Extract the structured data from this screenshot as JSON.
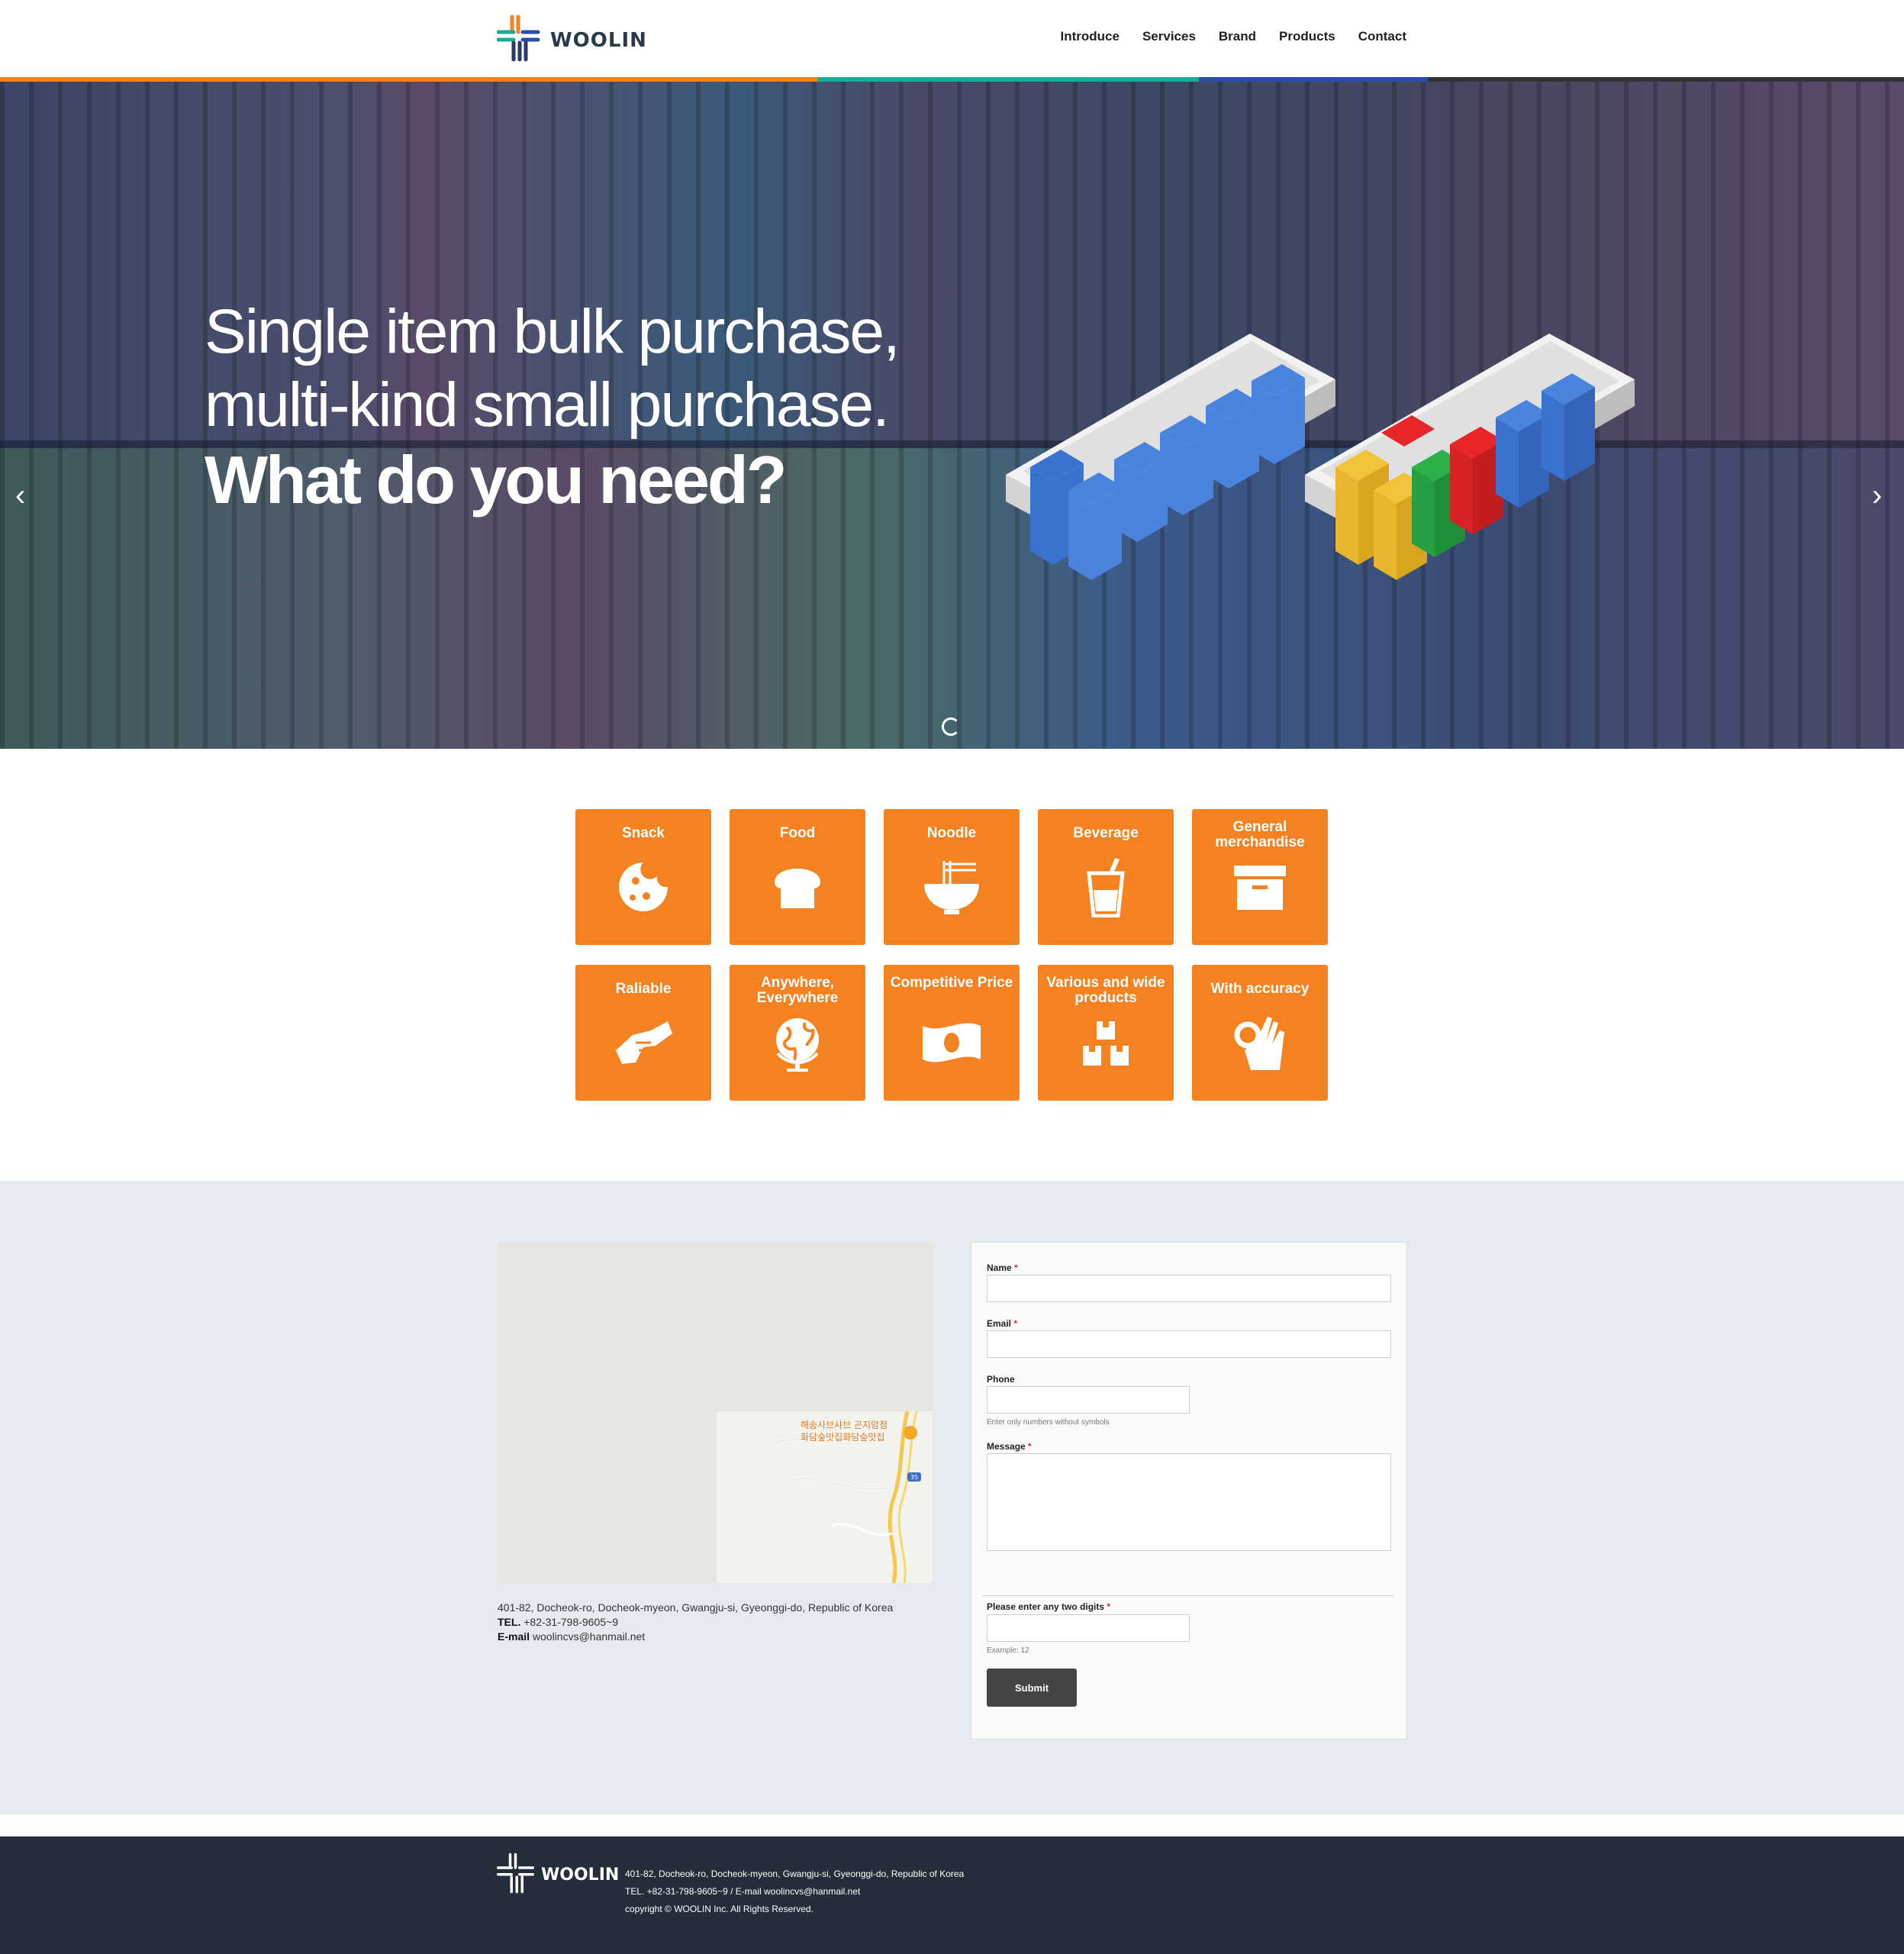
{
  "brand": {
    "name": "WOOLIN"
  },
  "nav": [
    {
      "label": "Introduce"
    },
    {
      "label": "Services"
    },
    {
      "label": "Brand"
    },
    {
      "label": "Products"
    },
    {
      "label": "Contact"
    }
  ],
  "accent_colors": {
    "orange": "#f58220",
    "teal": "#1ea89a",
    "blue": "#2a4ea8"
  },
  "hero": {
    "line1": "Single item bulk purchase,",
    "line2": "multi-kind small purchase.",
    "line3": "What do you need?",
    "prev_icon": "chevron-left-icon",
    "next_icon": "chevron-right-icon"
  },
  "tiles": [
    {
      "label": "Snack",
      "icon": "cookie-icon"
    },
    {
      "label": "Food",
      "icon": "bread-icon"
    },
    {
      "label": "Noodle",
      "icon": "noodle-bowl-icon"
    },
    {
      "label": "Beverage",
      "icon": "drink-cup-icon"
    },
    {
      "label": "General merchandise",
      "icon": "archive-box-icon"
    },
    {
      "label": "Raliable",
      "icon": "handshake-icon"
    },
    {
      "label": "Anywhere, Everywhere",
      "icon": "globe-icon"
    },
    {
      "label": "Competitive Price",
      "icon": "money-bill-icon"
    },
    {
      "label": "Various and wide products",
      "icon": "boxes-icon"
    },
    {
      "label": "With accuracy",
      "icon": "ok-hand-icon"
    }
  ],
  "map": {
    "label1": "해송사브샤브 곤지암점",
    "label2": "화담숲맛집화담숲맛집",
    "road": "35"
  },
  "contact": {
    "address": "401-82, Docheok-ro, Docheok-myeon, Gwangju-si, Gyeonggi-do, Republic of Korea",
    "tel_label": "TEL.",
    "tel": "+82-31-798-9605~9",
    "email_label": "E-mail",
    "email": "woolincvs@hanmail.net"
  },
  "form": {
    "name_label": "Name",
    "email_label": "Email",
    "phone_label": "Phone",
    "phone_hint": "Enter only numbers without symbols",
    "message_label": "Message",
    "digits_label": "Please enter any two digits",
    "digits_hint": "Example: 12",
    "required_mark": "*",
    "submit_label": "Submit"
  },
  "footer": {
    "address": "401-82, Docheok-ro, Docheok-myeon, Gwangju-si, Gyeonggi-do, Republic of Korea",
    "contact_line": "TEL. +82-31-798-9605~9 / E-mail woolincvs@hanmail.net",
    "copyright": "copyright © WOOLIN Inc. All Rights Reserved."
  }
}
